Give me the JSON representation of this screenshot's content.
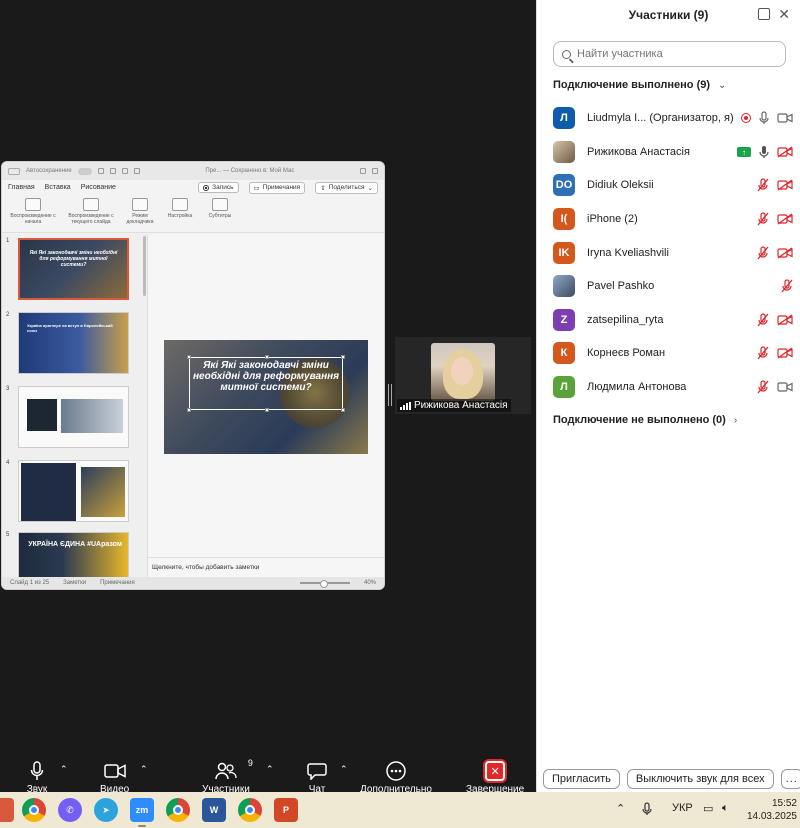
{
  "ppt": {
    "autosave": "Автосохранение",
    "doc_title": "Пре... — Сохранено в: Мой Мас",
    "tabs": [
      "Главная",
      "Вставка",
      "Рисование"
    ],
    "record": "Запись",
    "comments": "Примечания",
    "share": "Поделиться",
    "ribbon": {
      "play_start": "Воспроизведение с начала",
      "play_current": "Воспроизведение с текущего слайда",
      "presenter": "Режим докладчика",
      "setup": "Настройка",
      "subtitles": "Субтитры"
    },
    "slide_numbers": [
      "1",
      "2",
      "3",
      "4",
      "5"
    ],
    "slide1_title": "Які Які законодавчі зміни необхідні для реформування митної системи?",
    "slide2_title": "Україна прагнере на вступ в Європейський союз",
    "slide5_title": "УКРАЇНА ЄДИНА #UAразом",
    "main_slide_title": "Які Які законодавчі зміни необхідні для реформування митної системи?",
    "notes_placeholder": "Щелкните, чтобы добавить заметки",
    "status": {
      "slide_of": "Слайд 1 из 25",
      "notes": "Заметки",
      "comments": "Примечания",
      "zoom": "40%"
    }
  },
  "speaker": {
    "name": "Рижикова Анастасія"
  },
  "toolbar": {
    "audio": "Звук",
    "video": "Видео",
    "participants": "Участники",
    "participants_count": "9",
    "chat": "Чат",
    "more": "Дополнительно",
    "end": "Завершение"
  },
  "panel": {
    "title": "Участники (9)",
    "search_placeholder": "Найти участника",
    "connected_section": "Подключение выполнено (9)",
    "not_connected_section": "Подключение не выполнено (0)",
    "participants": [
      {
        "initials": "Л",
        "name": "Liudmyla I...  (Организатор, я)",
        "color": "#0e5cab"
      },
      {
        "initials": "",
        "name": "Рижикова Анастасія",
        "color": "#b89a7a"
      },
      {
        "initials": "DO",
        "name": "Didiuk Oleksii",
        "color": "#2f6fb5"
      },
      {
        "initials": "I(",
        "name": "iPhone (2)",
        "color": "#d4571e"
      },
      {
        "initials": "IK",
        "name": "Iryna Kveliashvili",
        "color": "#d4571e"
      },
      {
        "initials": "",
        "name": "Pavel Pashko",
        "color": "#5a6b82"
      },
      {
        "initials": "Z",
        "name": "zatsepilina_ryta",
        "color": "#7d3fb0"
      },
      {
        "initials": "К",
        "name": "Корнеєв Роман",
        "color": "#d4571e"
      },
      {
        "initials": "Л",
        "name": "Людмила Антонова",
        "color": "#5aa33a"
      }
    ],
    "invite": "Пригласить",
    "mute_all": "Выключить звук для всех",
    "more": "..."
  },
  "taskbar": {
    "lang": "УКР",
    "time": "15:52",
    "date": "14.03.2025"
  },
  "colors": {
    "zoom_bg": "#1a1a1a",
    "end_red": "#e02828",
    "muted_red": "#e0242a",
    "taskbar": "#efe8d2"
  }
}
